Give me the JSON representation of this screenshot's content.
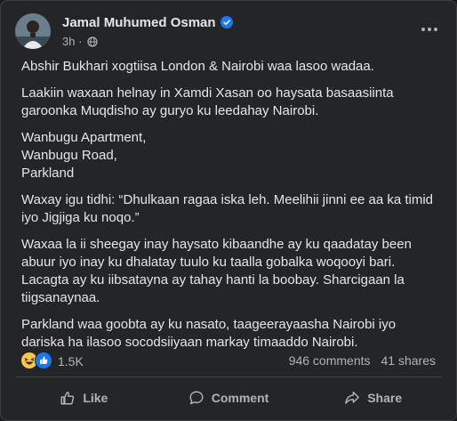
{
  "post": {
    "author_name": "Jamal Muhumed Osman",
    "timestamp": "3h",
    "separator": "·",
    "paragraphs": [
      "Abshir Bukhari xogtiisa London & Nairobi waa lasoo wadaa.",
      "Laakiin waxaan helnay in Xamdi Xasan oo haysata basaasiinta garoonka Muqdisho ay guryo ku leedahay Nairobi.",
      "Wanbugu Apartment,\nWanbugu Road,\nParkland",
      "Waxay igu tidhi: “Dhulkaan ragaa iska leh. Meelihii jinni ee aa ka timid iyo Jigjiga ku noqo.”",
      "Waxaa la ii sheegay inay haysato kibaandhe ay ku qaadatay been abuur iyo inay ku dhalatay tuulo ku taalla gobalka woqooyi bari. Lacagta ay ku iibsatayna ay tahay hanti la boobay. Sharcigaan la tiigsanaynaa.",
      "Parkland waa goobta ay ku nasato, taageerayaasha Nairobi iyo dariska ha ilasoo socodsiiyaan markay timaaddo Nairobi."
    ]
  },
  "stats": {
    "reactions_count": "1.5K",
    "comments": "946 comments",
    "shares": "41 shares"
  },
  "actions": {
    "like": "Like",
    "comment": "Comment",
    "share": "Share"
  },
  "icons": {
    "verified": "verified-badge-icon",
    "audience": "globe-icon",
    "more": "more-options-icon",
    "reactions": [
      "laughing-emoji-icon",
      "like-reaction-icon"
    ]
  },
  "colors": {
    "card_bg": "#242526",
    "text_primary": "#e4e6eb",
    "text_secondary": "#b0b3b8",
    "verified_blue": "#1877f2"
  }
}
